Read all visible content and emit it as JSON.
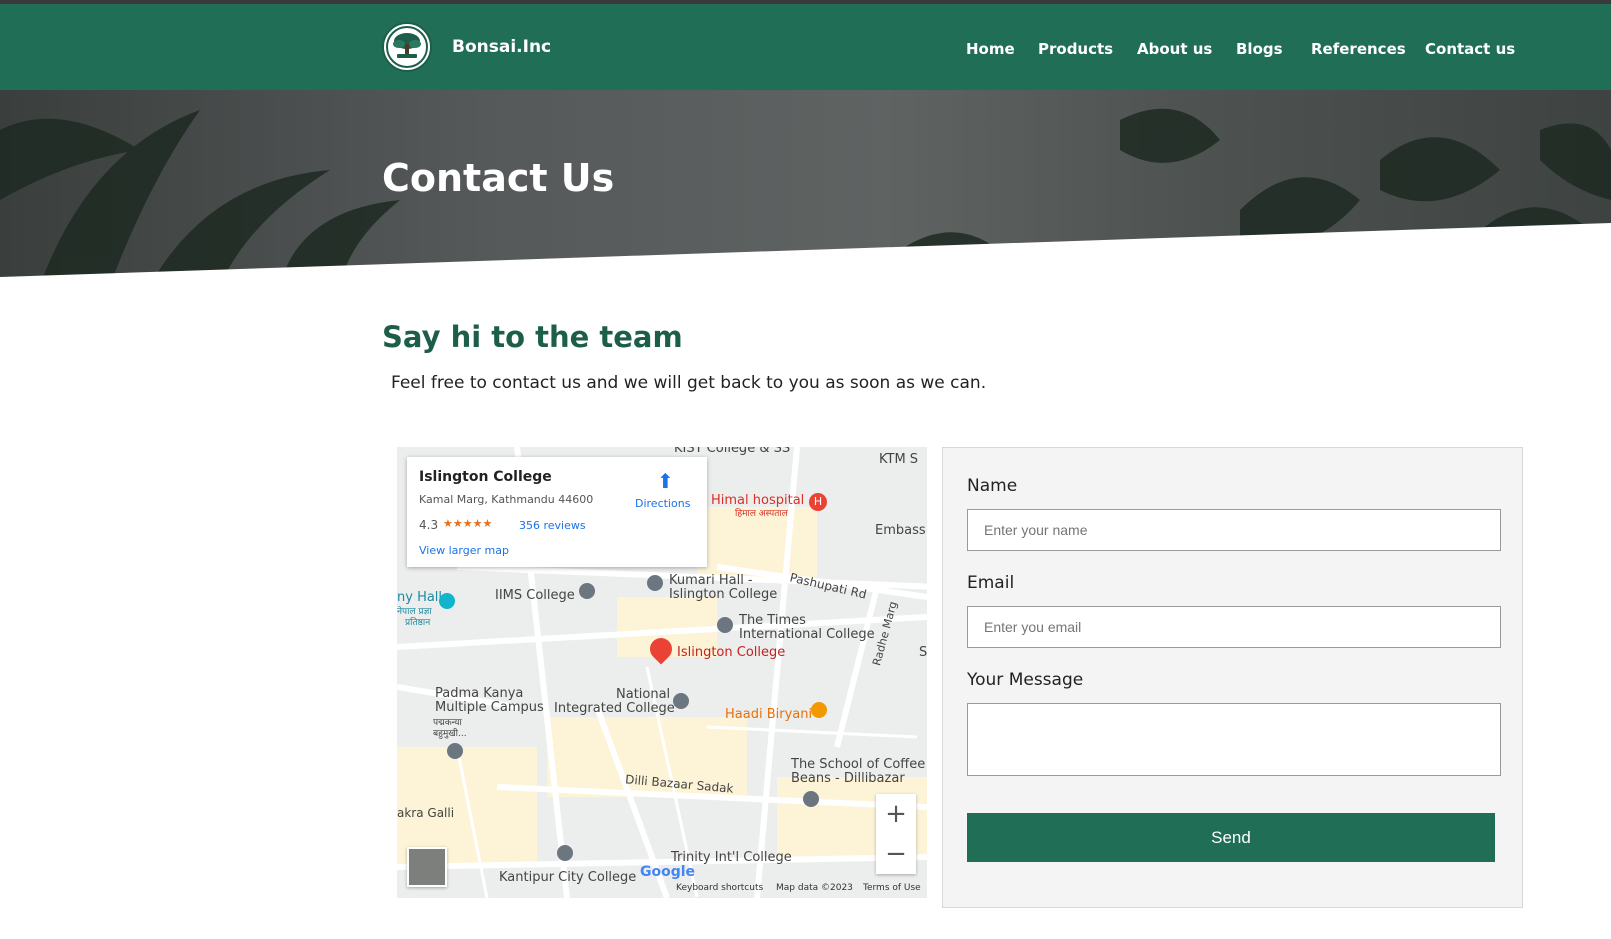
{
  "brand": {
    "name": "Bonsai.Inc"
  },
  "nav": {
    "home": "Home",
    "products": "Products",
    "about": "About us",
    "blogs": "Blogs",
    "references": "References",
    "contact": "Contact us"
  },
  "hero": {
    "title": "Contact Us"
  },
  "section": {
    "heading": "Say hi to the team",
    "subtext": "Feel free to contact us and we will get back to you as soon as we can."
  },
  "map": {
    "place_name": "Islington College",
    "address": "Kamal Marg, Kathmandu 44600",
    "rating": "4.3",
    "stars": "★★★★★",
    "reviews": "356 reviews",
    "view_larger": "View larger map",
    "directions": "Directions",
    "labels": {
      "kist": "KIST College & SS",
      "ktm": "KTM S",
      "himal": "Himal hospital",
      "himal_np": "हिमाल अस्पताल",
      "embass": "Embass",
      "pashupati": "Pashupati Rd",
      "kumari": "Kumari Hall -",
      "kumari2": "Islington College",
      "iims": "IIMS College",
      "hall": "ny Hall",
      "hall_np": "नेपाल प्रज्ञा",
      "hall_np2": "प्रतिष्ठान",
      "times": "The Times",
      "times2": "International College",
      "islington_pin": "Islington College",
      "radhe": "Radhe Marg",
      "padma": "Padma Kanya",
      "padma2": "Multiple Campus",
      "padma_np": "पद्मकन्या",
      "padma_np2": "बहुमुखी...",
      "national": "National",
      "national2": "Integrated College",
      "haadi": "Haadi Biryani",
      "coffee": "The School of Coffee",
      "coffee2": "Beans - Dillibazar",
      "dilli": "Dilli Bazaar Sadak",
      "akra": "akra Galli",
      "trinity": "Trinity Int'l College",
      "kantipur": "Kantipur City College",
      "s_right": "S"
    },
    "google": "Google",
    "shortcuts": "Keyboard shortcuts",
    "mapdata": "Map data ©2023",
    "terms": "Terms of Use",
    "zoom_in": "+",
    "zoom_out": "−"
  },
  "form": {
    "name_label": "Name",
    "name_placeholder": "Enter your name",
    "email_label": "Email",
    "email_placeholder": "Enter you email",
    "message_label": "Your Message",
    "message_placeholder": "",
    "send_label": "Send"
  },
  "colors": {
    "header": "#216e57",
    "heading": "#1d5e4b",
    "button": "#216e57"
  }
}
